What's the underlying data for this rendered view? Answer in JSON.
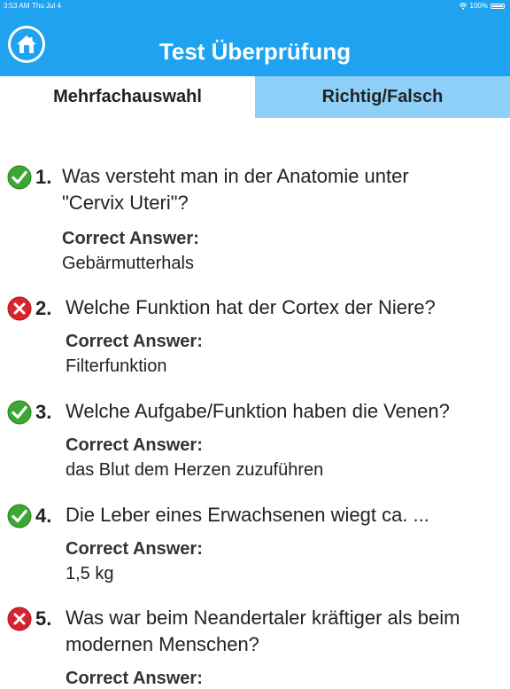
{
  "status_bar": {
    "time": "3:53 AM",
    "date": "Thu Jul 4",
    "battery": "100%"
  },
  "header": {
    "title": "Test Überprüfung",
    "home_icon": "home-icon"
  },
  "tabs": [
    {
      "label": "Mehrfachauswahl",
      "active": true
    },
    {
      "label": "Richtig/Falsch",
      "active": false
    }
  ],
  "answer_label": "Correct Answer:",
  "questions": [
    {
      "number": "1.",
      "text_line1": "Was versteht man in der Anatomie unter",
      "text_line2": "\"Cervix Uteri\"?",
      "answer": "Gebärmutterhals",
      "correct": true
    },
    {
      "number": "2.",
      "text_line1": "Welche Funktion hat der Cortex der Niere?",
      "text_line2": "",
      "answer": "Filterfunktion",
      "correct": false
    },
    {
      "number": "3.",
      "text_line1": "Welche Aufgabe/Funktion haben die Venen?",
      "text_line2": "",
      "answer": "das Blut dem Herzen zuzuführen",
      "correct": true
    },
    {
      "number": "4.",
      "text_line1": "Die Leber eines Erwachsenen wiegt ca. ...",
      "text_line2": "",
      "answer": "1,5 kg",
      "correct": true
    },
    {
      "number": "5.",
      "text_line1": "Was war beim Neandertaler kräftiger als beim",
      "text_line2": "modernen Menschen?",
      "answer": "",
      "correct": false
    }
  ],
  "colors": {
    "accent": "#1fa2f0",
    "tab_inactive": "#8fd0f8",
    "correct": "#3aa832",
    "wrong": "#d9232d"
  }
}
